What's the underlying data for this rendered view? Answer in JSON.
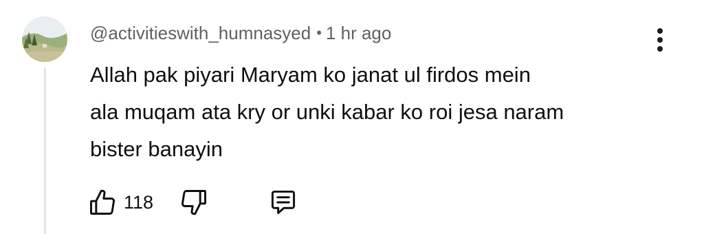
{
  "comment": {
    "author": "@activitieswith_humnasyed",
    "separator": "•",
    "timestamp": "1 hr ago",
    "lines": [
      "Allah pak piyari Maryam ko janat ul firdos mein",
      "ala muqam ata kry or unki kabar ko roi jesa naram",
      "bister banayin"
    ],
    "like_count": "118"
  },
  "icons": {
    "avatar": "landscape-avatar",
    "menu": "more-vertical-icon",
    "like": "thumbs-up-icon",
    "dislike": "thumbs-down-icon",
    "reply": "comment-reply-icon"
  },
  "colors": {
    "text_primary": "#0f0f0f",
    "text_secondary": "#606060",
    "thread_line": "#e5e5e5"
  }
}
